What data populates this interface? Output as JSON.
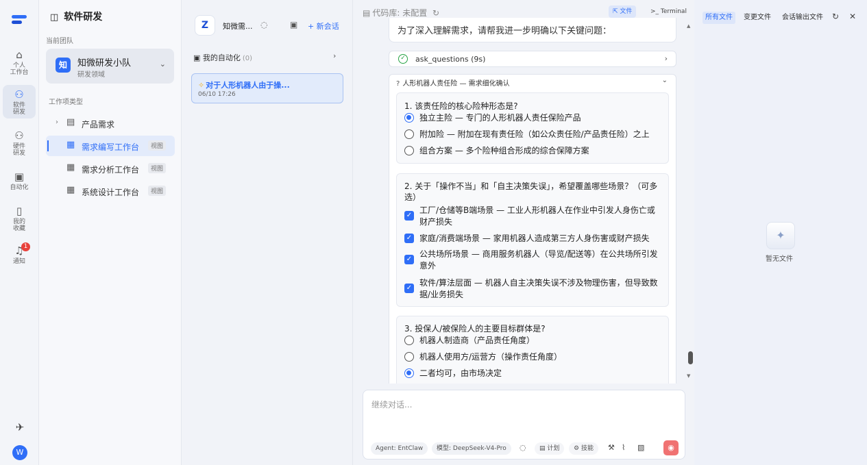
{
  "rail": {
    "items": [
      {
        "label": "个人\n工作台",
        "icon": "home-icon"
      },
      {
        "label": "软件\n研发",
        "icon": "users-icon"
      },
      {
        "label": "硬件\n研发",
        "icon": "users-icon"
      },
      {
        "label": "自动化",
        "icon": "calendar-clock-icon"
      },
      {
        "label": "我的\n收藏",
        "icon": "bookmark-icon"
      },
      {
        "label": "通知",
        "icon": "bell-icon",
        "badge": "1"
      }
    ],
    "avatar": "W"
  },
  "sidebar": {
    "title": "软件研发",
    "current_team_label": "当前团队",
    "team": {
      "logo": "知",
      "name": "知微研发小队",
      "desc": "研发领域"
    },
    "section_label": "工作项类型",
    "items": [
      {
        "label": "产品需求",
        "tag": ""
      },
      {
        "label": "需求编写工作台",
        "tag": "视图"
      },
      {
        "label": "需求分析工作台",
        "tag": "视图"
      },
      {
        "label": "系统设计工作台",
        "tag": "视图"
      }
    ]
  },
  "sessions": {
    "app_name": "知微需...",
    "new_label": "+ 新会话",
    "automation_label": "我的自动化",
    "automation_count": "(0)",
    "conversation": {
      "title": "对于人形机器人由于操...",
      "time": "06/10 17:26"
    }
  },
  "main": {
    "repo_label": "代码库: 未配置",
    "files_button": "文件",
    "terminal_button": "Terminal",
    "intro": "为了深入理解需求，请帮我进一步明确以下关键问题：",
    "tool": {
      "name": "ask_questions (9s)"
    },
    "panel_title": "人形机器人责任险 — 需求细化确认",
    "questions": [
      {
        "title": "1. 该责任险的核心险种形态是?",
        "type": "radio",
        "options": [
          {
            "text": "独立主险 — 专门的人形机器人责任保险产品",
            "selected": true
          },
          {
            "text": "附加险 — 附加在现有责任险（如公众责任险/产品责任险）之上",
            "selected": false
          },
          {
            "text": "组合方案 — 多个险种组合形成的综合保障方案",
            "selected": false
          }
        ]
      },
      {
        "title": "2. 关于「操作不当」和「自主决策失误」，希望覆盖哪些场景？（可多选）",
        "type": "checkbox",
        "options": [
          {
            "text": "工厂/仓储等B端场景 — 工业人形机器人在作业中引发人身伤亡或财产损失",
            "selected": true
          },
          {
            "text": "家庭/消费端场景 — 家用机器人造成第三方人身伤害或财产损失",
            "selected": true
          },
          {
            "text": "公共场所场景 — 商用服务机器人（导览/配送等）在公共场所引发意外",
            "selected": true
          },
          {
            "text": "软件/算法层面 — 机器人自主决策失误不涉及物理伤害，但导致数据/业务损失",
            "selected": true
          }
        ]
      },
      {
        "title": "3. 投保人/被保险人的主要目标群体是?",
        "type": "radio",
        "options": [
          {
            "text": "机器人制造商（产品责任角度）",
            "selected": false
          },
          {
            "text": "机器人使用方/运营方（操作责任角度）",
            "selected": false
          },
          {
            "text": "二者均可，由市场决定",
            "selected": true
          }
        ]
      }
    ],
    "composer": {
      "placeholder": "继续对话...",
      "agent": "Agent: EntClaw",
      "model": "模型: DeepSeek-V4-Pro",
      "plan": "计划",
      "skills": "技能"
    }
  },
  "files": {
    "tabs": [
      "所有文件",
      "变更文件",
      "会话输出文件"
    ],
    "empty": "暂无文件"
  }
}
